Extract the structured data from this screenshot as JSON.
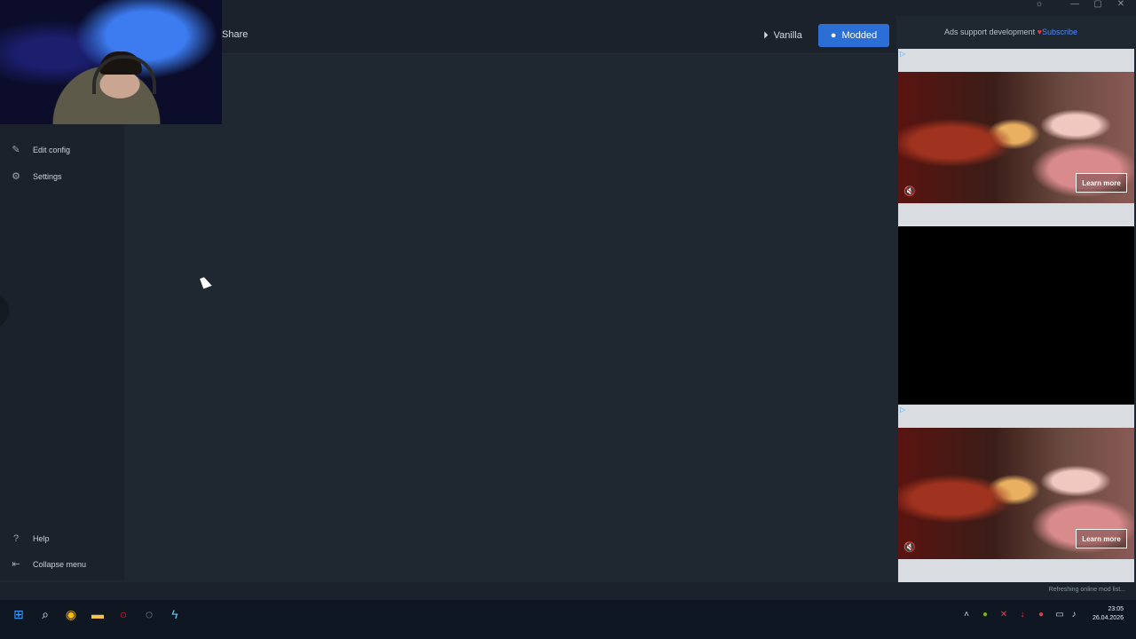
{
  "window": {
    "controls": [
      "☼",
      "—",
      "▢",
      "✕"
    ]
  },
  "header": {
    "share_label": "Share",
    "vanilla_label": "Vanilla",
    "modded_label": "Modded"
  },
  "sidebar": {
    "items": [
      {
        "label": "Edit config",
        "icon": "edit-icon"
      },
      {
        "label": "Settings",
        "icon": "gear-icon"
      }
    ],
    "bottom": [
      {
        "label": "Help",
        "icon": "help-icon"
      },
      {
        "label": "Collapse menu",
        "icon": "collapse-icon"
      }
    ]
  },
  "ads": {
    "support_text": "Ads support development",
    "subscribe_label": "Subscribe",
    "learn_more": "Learn more"
  },
  "status": {
    "text": "Refreshing online mod list..."
  },
  "taskbar": {
    "time": "23:05",
    "date": "26.04.2026"
  },
  "colors": {
    "accent": "#2b6fd6",
    "background": "#1f2731",
    "heart": "#e53b4b",
    "link": "#4a8dff"
  }
}
